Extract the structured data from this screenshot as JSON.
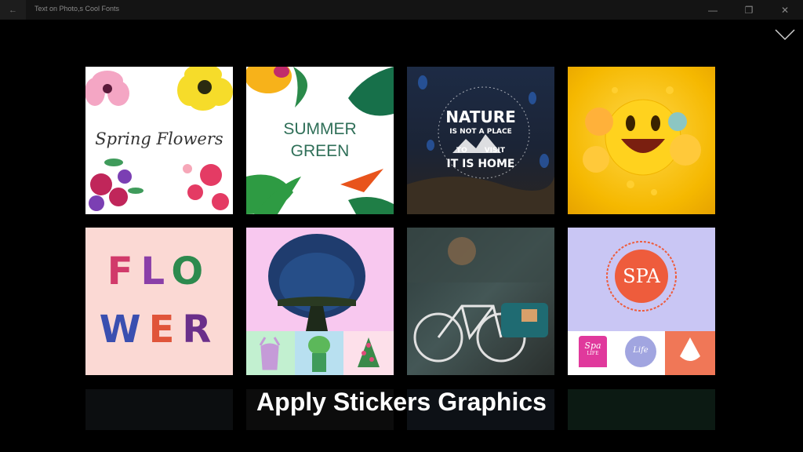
{
  "window": {
    "title": "Text on Photo,s Cool Fonts"
  },
  "tiles": {
    "spring": "Spring Flowers",
    "summer_line1": "SUMMER",
    "summer_line2": "GREEN",
    "nature": [
      "NATURE",
      "IS NOT A PLACE",
      "TO",
      "VISIT",
      "IT IS HOME"
    ],
    "flower_letters": [
      "F",
      "L",
      "O",
      "W",
      "E",
      "R"
    ],
    "spa": "SPA",
    "spa_small_1": "Spa",
    "spa_small_1b": "LIFE",
    "spa_small_2": "Life"
  },
  "caption": "Apply Stickers Graphics",
  "colors": {
    "background": "#000000",
    "titlebar": "#141414",
    "summer_green": "#2f6f58",
    "spa_orange": "#ee5c3c"
  }
}
